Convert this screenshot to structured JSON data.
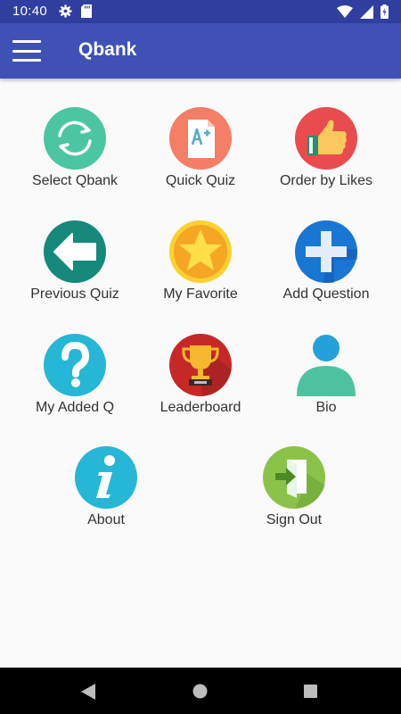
{
  "status_bar": {
    "time": "10:40",
    "left_icons": [
      "gear-icon",
      "sd-card-icon"
    ],
    "right_icons": [
      "wifi-icon",
      "signal-icon",
      "battery-icon"
    ]
  },
  "app_bar": {
    "title": "Qbank",
    "menu_icon": "hamburger-menu-icon"
  },
  "menu_tiles": [
    {
      "label": "Select Qbank",
      "icon": "refresh-cycle-icon",
      "color": "#4cc5a3"
    },
    {
      "label": "Quick Quiz",
      "icon": "a-plus-document-icon",
      "color": "#f47e66"
    },
    {
      "label": "Order by Likes",
      "icon": "thumbs-up-icon",
      "color": "#e84c4f"
    },
    {
      "label": "Previous Quiz",
      "icon": "arrow-left-icon",
      "color": "#14897c"
    },
    {
      "label": "My Favorite",
      "icon": "star-icon",
      "color": "#fbb729"
    },
    {
      "label": "Add Question",
      "icon": "plus-icon",
      "color": "#1976d2"
    },
    {
      "label": "My Added Q",
      "icon": "question-mark-icon",
      "color": "#26b7d6"
    },
    {
      "label": "Leaderboard",
      "icon": "trophy-icon",
      "color": "#c62828"
    },
    {
      "label": "Bio",
      "icon": "person-icon",
      "color": "#4dc2a1"
    },
    {
      "label": "About",
      "icon": "info-icon",
      "color": "#26b7d6"
    },
    {
      "label": "Sign Out",
      "icon": "sign-out-icon",
      "color": "#8bc34a"
    }
  ],
  "nav_bar": {
    "buttons": [
      "back-icon",
      "home-icon",
      "recents-icon"
    ]
  }
}
